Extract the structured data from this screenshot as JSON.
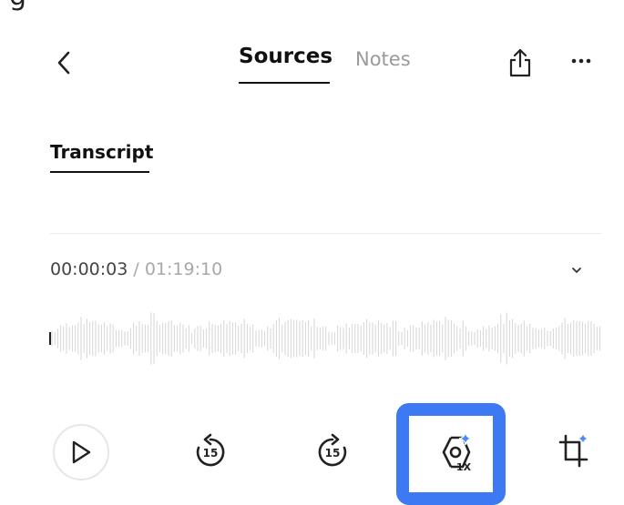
{
  "clipped_text": "g",
  "header": {
    "back_icon": "chevron-left-icon",
    "tabs": [
      {
        "label": "Sources",
        "active": true
      },
      {
        "label": "Notes",
        "active": false
      }
    ],
    "share_icon": "share-icon",
    "more_icon": "more-icon"
  },
  "transcript_tab": {
    "label": "Transcript"
  },
  "player": {
    "current_time": "00:00:03",
    "separator": " / ",
    "total_time": "01:19:10",
    "expand_icon": "chevron-down-icon",
    "progress_fraction": 0.0007
  },
  "controls": {
    "play_icon": "play-icon",
    "rewind_label": "15",
    "forward_label": "15",
    "speed_label": "1X",
    "crop_icon": "crop-sparkle-icon",
    "highlight_color": "#3d79f2",
    "sparkle_color": "#4a8df7"
  }
}
